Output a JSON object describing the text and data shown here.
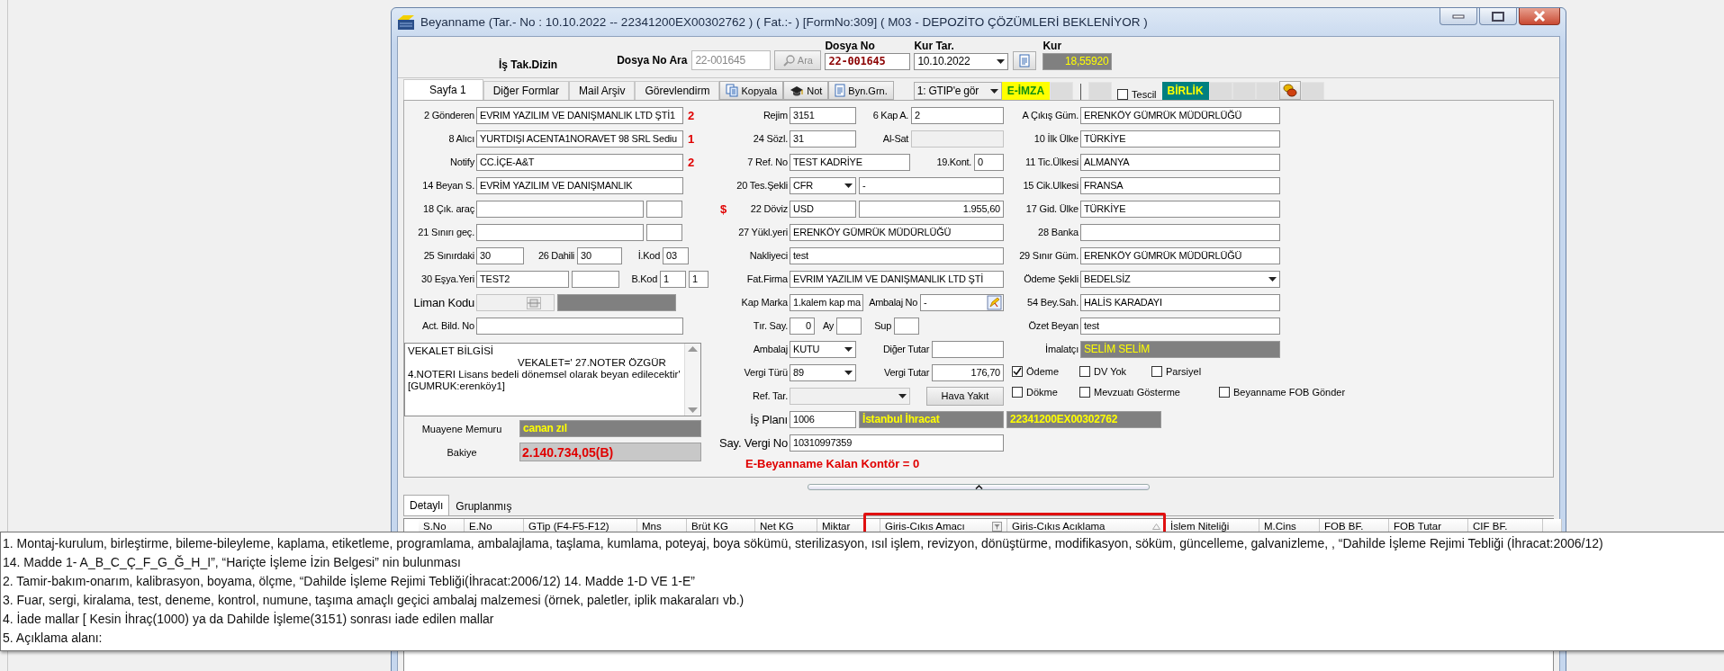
{
  "window": {
    "title": "Beyanname (Tar.- No : 10.10.2022 -- 22341200EX00302762 ) ( Fat.:- )  [FormNo:309] ( M03 - DEPOZİTO ÇÖZÜMLERİ BEKLENİYOR )"
  },
  "header": {
    "folder_label": "İş Tak.Dizin",
    "search_label": "Dosya No Ara",
    "search_value": "22-001645",
    "search_button": "Ara",
    "file_no_label": "Dosya No",
    "file_no": "22-001645",
    "rate_date_label": "Kur Tar.",
    "rate_date": "10.10.2022",
    "rate_label": "Kur",
    "rate": "18,55920"
  },
  "toolbar": [
    {
      "kind": "tab",
      "label": "Sayfa 1",
      "selected": true
    },
    {
      "kind": "tab",
      "label": "Diğer Formlar",
      "selected": false
    },
    {
      "kind": "tab",
      "label": "Mail Arşiv",
      "selected": false
    },
    {
      "kind": "tab",
      "label": "Görevlendirm",
      "selected": false
    },
    {
      "kind": "copy",
      "label": "Kopyala"
    },
    {
      "kind": "note",
      "label": "Not"
    },
    {
      "kind": "doc",
      "label": "Byn.Grn."
    },
    {
      "kind": "dropdown",
      "value": "1: GTIP'e gör"
    },
    {
      "kind": "badge",
      "label": "E-İMZA",
      "color": "#ffff00"
    },
    {
      "kind": "blank"
    },
    {
      "kind": "separator"
    },
    {
      "kind": "blank"
    },
    {
      "kind": "checkbox",
      "label": "Tescil",
      "checked": false
    },
    {
      "kind": "badge",
      "label": "BİRLİK",
      "color": "#008080"
    },
    {
      "kind": "blank"
    },
    {
      "kind": "blank"
    },
    {
      "kind": "blank"
    },
    {
      "kind": "coins"
    },
    {
      "kind": "blank"
    }
  ],
  "left": {
    "rows": [
      {
        "label": "2 Gönderen",
        "items": [
          {
            "kind": "input",
            "value": "EVRIM YAZILIM VE DANIŞMANLIK LTD ŞTİ1"
          }
        ],
        "mark": "2"
      },
      {
        "label": "8 Alıcı",
        "items": [
          {
            "kind": "input",
            "value": "YURTDIŞI ACENTA1NORAVET 98 SRL Sediu"
          }
        ],
        "mark": "1"
      },
      {
        "label": "Notify",
        "items": [
          {
            "kind": "input",
            "value": "CC.İÇE-A&T"
          }
        ],
        "mark": "2"
      },
      {
        "label": "14 Beyan S.",
        "items": [
          {
            "kind": "input",
            "value": "EVRİM YAZILIM VE DANIŞMANLIK"
          }
        ]
      },
      {
        "label": "18 Çık. araç",
        "items": [
          {
            "kind": "input"
          },
          {
            "kind": "input"
          }
        ]
      },
      {
        "label": "21 Sınırı geç.",
        "items": [
          {
            "kind": "input"
          },
          {
            "kind": "input"
          }
        ]
      },
      {
        "label": "25 Sınırdaki",
        "items": [
          {
            "kind": "input",
            "value": "30"
          },
          {
            "kind": "label",
            "text": "26 Dahili"
          },
          {
            "kind": "input",
            "value": "30"
          },
          {
            "kind": "label",
            "text": "İ.Kod"
          },
          {
            "kind": "input",
            "value": "03"
          }
        ]
      },
      {
        "label": "30 Eşya.Yeri",
        "items": [
          {
            "kind": "input",
            "value": "TEST2"
          },
          {
            "kind": "input"
          },
          {
            "kind": "label",
            "text": "B.Kod"
          },
          {
            "kind": "input",
            "value": "1"
          },
          {
            "kind": "input",
            "value": "1"
          }
        ]
      },
      {
        "label": "Liman Kodu",
        "items": [
          {
            "kind": "lookup"
          },
          {
            "kind": "dark"
          }
        ]
      },
      {
        "label": "Act. Bild. No",
        "items": [
          {
            "kind": "input"
          }
        ]
      }
    ],
    "notes": [
      "VEKALET BİLGİSİ",
      "VEKALET=' 27.NOTER ÖZGÜR",
      "4.NOTERI Lisans bedeli dönemsel olarak beyan edilecektir'",
      "[GUMRUK:erenköy1]"
    ],
    "inspector": {
      "label": "Muayene Memuru",
      "value": "canan zıl"
    },
    "balance": {
      "label": "Bakiye",
      "value": "2.140.734,05(B)"
    }
  },
  "middle": {
    "rows": [
      {
        "label": "Rejim",
        "items": [
          {
            "kind": "input",
            "value": "3151"
          },
          {
            "kind": "label",
            "text": "6 Kap A."
          },
          {
            "kind": "input",
            "value": "2"
          }
        ]
      },
      {
        "label": "24 Sözl.",
        "items": [
          {
            "kind": "input",
            "value": "31"
          },
          {
            "kind": "label",
            "text": "Al-Sat"
          },
          {
            "kind": "readonly"
          }
        ]
      },
      {
        "label": "7 Ref. No",
        "items": [
          {
            "kind": "input",
            "value": "TEST KADRİYE"
          },
          {
            "kind": "label",
            "text": "19.Kont."
          },
          {
            "kind": "input",
            "value": "0"
          }
        ]
      },
      {
        "label": "20 Tes.Şekli",
        "items": [
          {
            "kind": "dropdown",
            "value": "CFR",
            "disabled": false
          },
          {
            "kind": "input",
            "value": "-"
          }
        ]
      },
      {
        "label": "22 Döviz",
        "prefix": "$",
        "items": [
          {
            "kind": "input",
            "value": "USD"
          },
          {
            "kind": "right",
            "value": "1.955,60"
          }
        ]
      },
      {
        "label": "27 Yükl.yeri",
        "items": [
          {
            "kind": "input",
            "value": "ERENKÖY GÜMRÜK MÜDÜRLÜĞÜ"
          }
        ]
      },
      {
        "label": "Nakliyeci",
        "items": [
          {
            "kind": "input",
            "value": "test"
          }
        ]
      },
      {
        "label": "Fat.Firma",
        "items": [
          {
            "kind": "input",
            "value": "EVRIM YAZILIM VE DANIŞMANLIK LTD ŞTİ"
          }
        ]
      },
      {
        "label": "Kap Marka",
        "items": [
          {
            "kind": "input",
            "value": "1.kalem kap ma"
          },
          {
            "kind": "label",
            "text": "Ambalaj No"
          },
          {
            "kind": "edit",
            "value": "-"
          }
        ]
      },
      {
        "label": "Tır. Say.",
        "items": [
          {
            "kind": "right",
            "value": "0"
          },
          {
            "kind": "label",
            "text": "Ay"
          },
          {
            "kind": "input"
          },
          {
            "kind": "label",
            "text": "Sup"
          },
          {
            "kind": "input"
          }
        ]
      },
      {
        "label": "Ambalaj",
        "items": [
          {
            "kind": "dropdown",
            "value": "KUTU",
            "disabled": false
          },
          {
            "kind": "label",
            "text": "Diğer Tutar"
          },
          {
            "kind": "input"
          }
        ]
      },
      {
        "label": "Vergi Türü",
        "items": [
          {
            "kind": "dropdown",
            "value": "89",
            "disabled": false
          },
          {
            "kind": "label",
            "text": "Vergi Tutar"
          },
          {
            "kind": "right",
            "value": "176,70"
          }
        ]
      },
      {
        "label": "Ref. Tar.",
        "items": [
          {
            "kind": "dropdown",
            "disabled": true
          },
          {
            "kind": "button",
            "text": "Hava Yakıt"
          }
        ]
      },
      {
        "label": "İş Planı",
        "items": [
          {
            "kind": "input",
            "value": "1006"
          },
          {
            "kind": "darkbold",
            "value": "İstanbul İhracat"
          },
          {
            "kind": "darkbold",
            "value": "22341200EX00302762"
          }
        ]
      },
      {
        "label": "Say. Vergi No",
        "items": [
          {
            "kind": "input",
            "value": "10310997359"
          }
        ]
      }
    ],
    "credit_notice": "E-Beyanname Kalan Kontör = 0"
  },
  "right": {
    "rows": [
      {
        "label": "A Çıkış Güm.",
        "items": [
          {
            "kind": "input",
            "value": "ERENKÖY GÜMRÜK MÜDÜRLÜĞÜ"
          }
        ]
      },
      {
        "label": "10 İlk Ülke",
        "items": [
          {
            "kind": "input",
            "value": "TÜRKİYE"
          }
        ]
      },
      {
        "label": "11 Tic.Ülkesi",
        "items": [
          {
            "kind": "input",
            "value": "ALMANYA"
          }
        ]
      },
      {
        "label": "15 Cik.Ulkesi",
        "items": [
          {
            "kind": "input",
            "value": "FRANSA"
          }
        ]
      },
      {
        "label": "17 Gid. Ülke",
        "items": [
          {
            "kind": "input",
            "value": "TÜRKİYE"
          }
        ]
      },
      {
        "label": "28 Banka",
        "items": [
          {
            "kind": "input"
          }
        ]
      },
      {
        "label": "29 Sınır Güm.",
        "items": [
          {
            "kind": "input",
            "value": "ERENKÖY GÜMRÜK MÜDÜRLÜĞÜ"
          }
        ]
      },
      {
        "label": "Ödeme Şekli",
        "items": [
          {
            "kind": "dropdown",
            "value": "BEDELSİZ",
            "disabled": false
          }
        ]
      },
      {
        "label": "54 Bey.Sah.",
        "items": [
          {
            "kind": "input",
            "value": "HALİS KARADAYI"
          }
        ]
      },
      {
        "label": "Özet Beyan",
        "items": [
          {
            "kind": "input",
            "value": "test"
          }
        ]
      },
      {
        "label": "İmalatçı",
        "items": [
          {
            "kind": "dark",
            "value": "SELİM SELİM"
          }
        ]
      }
    ],
    "options": [
      {
        "label": "Ödeme",
        "checked": true
      },
      {
        "label": "DV Yok",
        "checked": false
      },
      {
        "label": "Parsiyel",
        "checked": false
      },
      {
        "label": "Dökme",
        "checked": false
      },
      {
        "label": "Mevzuatı Gösterme",
        "checked": false
      },
      {
        "label": "Beyanname FOB Gönder",
        "checked": false
      }
    ]
  },
  "lower_tabs": [
    {
      "label": "Detaylı",
      "selected": true
    },
    {
      "label": "Gruplanmış",
      "selected": false
    }
  ],
  "table": {
    "columns": [
      {
        "label": "S.No",
        "kind": "plain"
      },
      {
        "label": "E.No",
        "kind": "plain"
      },
      {
        "label": "GTip (F4-F5-F12)",
        "kind": "plain"
      },
      {
        "label": "Mns",
        "kind": "plain"
      },
      {
        "label": "Brüt KG",
        "kind": "plain"
      },
      {
        "label": "Net KG",
        "kind": "plain"
      },
      {
        "label": "Miktar",
        "kind": "plain"
      },
      {
        "label": "Giris-Cıkıs Amacı",
        "kind": "filter"
      },
      {
        "label": "Giris-Cıkıs Acıklama",
        "kind": "sort"
      },
      {
        "label": "İslem Niteliği",
        "kind": "plain"
      },
      {
        "label": "M.Cins",
        "kind": "plain"
      },
      {
        "label": "FOB BF.",
        "kind": "plain"
      },
      {
        "label": "FOB Tutar",
        "kind": "plain"
      },
      {
        "label": "CIF BF.",
        "kind": "plain"
      },
      {
        "kind": "plain"
      }
    ]
  },
  "tooltip": {
    "lines": [
      "1. Montaj-kurulum, birleştirme, bileme-bileyleme, kaplama, etiketleme, programlama, ambalajlama, taşlama, kumlama, poteyaj, boya sökümü, sterilizasyon, ısıl işlem, revizyon, dönüştürme, modifikasyon, söküm, güncelleme, galvanizleme, ,  “Dahilde İşleme Rejimi Tebliği (İhracat:2006/12)",
      "14. Madde 1- A_B_C_Ç_F_G_Ğ_H_I”, “Hariçte İşleme İzin Belgesi” nin bulunması",
      "2. Tamir-bakım-onarım, kalibrasyon, boyama, ölçme,  “Dahilde İşleme Rejimi Tebliği(İhracat:2006/12) 14. Madde 1-D VE 1-E”",
      "3. Fuar, sergi, kiralama, test, deneme, kontrol, numune, taşıma amaçlı geçici ambalaj malzemesi (örnek, paletler, iplik makaraları vb.)",
      "4. İade mallar [ Kesin İhraç(1000) ya da Dahilde İşleme(3151) sonrası iade edilen mallar",
      "5. Açıklama alanı:"
    ]
  }
}
